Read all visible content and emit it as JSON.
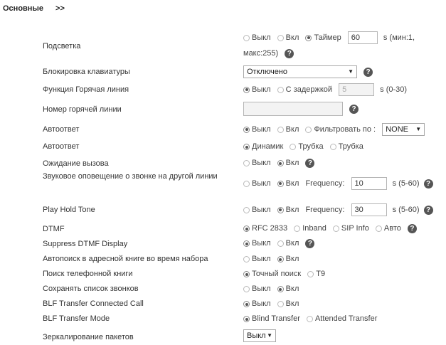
{
  "section": {
    "title": "Основные",
    "arrows": ">>"
  },
  "help_glyph": "?",
  "rows": {
    "backlight": {
      "label": "Подсветка",
      "opt1": "Выкл",
      "opt2": "Вкл",
      "opt3": "Таймер",
      "value": "60",
      "unit": "s (мин:1,",
      "unit2": "макс:255)"
    },
    "keylock": {
      "label": "Блокировка клавиатуры",
      "value": "Отключено"
    },
    "hotline": {
      "label": "Функция Горячая линия",
      "opt1": "Выкл",
      "opt2": "С задержкой",
      "value": "5",
      "unit": "s (0-30)"
    },
    "hotline_number": {
      "label": "Номер горячей линии",
      "value": ""
    },
    "autoanswer1": {
      "label": "Автоответ",
      "opt1": "Выкл",
      "opt2": "Вкл",
      "opt3": "Фильтровать по :",
      "filter": "NONE"
    },
    "autoanswer2": {
      "label": "Автоответ",
      "opt1": "Динамик",
      "opt2": "Трубка",
      "opt3": "Трубка"
    },
    "call_waiting": {
      "label": "Ожидание вызова",
      "opt1": "Выкл",
      "opt2": "Вкл"
    },
    "ring_other_line": {
      "label": "Звуковое оповещение о звонке на другой линии",
      "opt1": "Выкл",
      "opt2": "Вкл",
      "freq_label": "Frequency:",
      "value": "10",
      "unit": "s (5-60)"
    },
    "play_hold_tone": {
      "label": "Play Hold Tone",
      "opt1": "Выкл",
      "opt2": "Вкл",
      "freq_label": "Frequency:",
      "value": "30",
      "unit": "s (5-60)"
    },
    "dtmf": {
      "label": "DTMF",
      "opt1": "RFC 2833",
      "opt2": "Inband",
      "opt3": "SIP Info",
      "opt4": "Авто"
    },
    "suppress_dtmf": {
      "label": "Suppress DTMF Display",
      "opt1": "Выкл",
      "opt2": "Вкл"
    },
    "autosearch": {
      "label": "Автопоиск в адресной книге во время набора",
      "opt1": "Выкл",
      "opt2": "Вкл"
    },
    "phonebook_search": {
      "label": "Поиск телефонной книги",
      "opt1": "Точный поиск",
      "opt2": "T9"
    },
    "save_call_log": {
      "label": "Сохранять список звонков",
      "opt1": "Выкл",
      "opt2": "Вкл"
    },
    "blf_connected": {
      "label": "BLF Transfer Connected Call",
      "opt1": "Выкл",
      "opt2": "Вкл"
    },
    "blf_mode": {
      "label": "BLF Transfer Mode",
      "opt1": "Blind Transfer",
      "opt2": "Attended Transfer"
    },
    "packet_mirror": {
      "label": "Зеркалирование пакетов",
      "value": "Выкл"
    }
  }
}
